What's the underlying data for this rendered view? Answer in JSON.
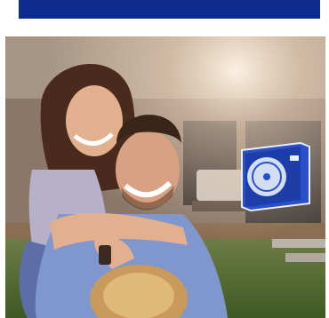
{
  "hero": {
    "image": "couple-piggyback-photo",
    "product_icon": "outdoor-ac-unit-icon"
  },
  "colors": {
    "banner": "#0d2b8c",
    "unit_body": "#2a4fc9",
    "unit_panel": "#e8eefc"
  }
}
